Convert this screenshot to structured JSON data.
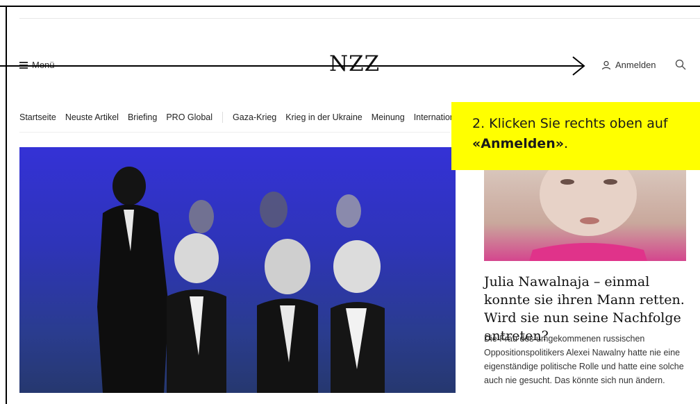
{
  "header": {
    "menu_label": "Menü",
    "logo": "NZZ",
    "login_label": "Anmelden"
  },
  "nav": {
    "items": [
      "Startseite",
      "Neuste Artikel",
      "Briefing",
      "PRO Global",
      "Gaza-Krieg",
      "Krieg in der Ukraine",
      "Meinung",
      "Internation"
    ]
  },
  "callout": {
    "text_before": "2. Klicken Sie rechts oben auf ",
    "text_bold": "«Anmelden»",
    "text_after": "."
  },
  "side_article": {
    "headline": "Julia Nawalnaja – einmal konnte sie ihren Mann retten. Wird sie nun seine Nachfolge antreten?",
    "teaser": "Die Frau des umgekommenen russischen Oppositionspolitikers Alexei Nawalny hatte nie eine eigenständige politische Rolle und hatte eine solche auch nie gesucht. Das könnte sich nun ändern."
  },
  "colors": {
    "callout_bg": "#ffff00",
    "hero_top": "#3432d6",
    "hero_bottom": "#26386f"
  },
  "icons": {
    "menu": "hamburger-icon",
    "login": "user-icon",
    "search": "search-icon"
  }
}
